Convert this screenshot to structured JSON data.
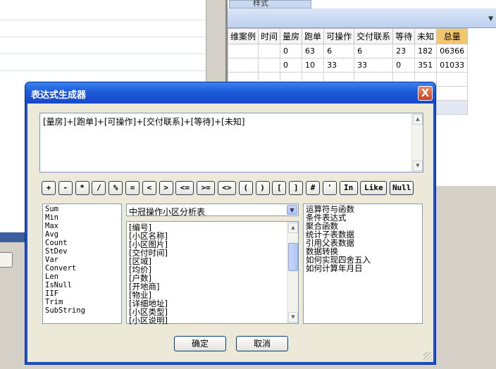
{
  "background": {
    "style_tab_label": "样式",
    "table": {
      "headers": [
        "维案例",
        "时间",
        "量房",
        "跑单",
        "可操作",
        "交付联系",
        "等待",
        "未知",
        "总量"
      ],
      "rows": [
        [
          "",
          "",
          "0",
          "63",
          "6",
          "6",
          "23",
          "182",
          "06366"
        ],
        [
          "",
          "",
          "0",
          "10",
          "33",
          "33",
          "0",
          "351",
          "01033"
        ]
      ]
    }
  },
  "dialog": {
    "title": "表达式生成器",
    "close_label": "X",
    "expression": "[量房]+[跑单]+[可操作]+[交付联系]+[等待]+[未知]",
    "operators": [
      "+",
      "-",
      "*",
      "/",
      "%",
      "=",
      "<",
      ">",
      "<=",
      ">=",
      "<>",
      "(",
      ")",
      "[",
      "]",
      "#",
      "'",
      "In",
      "Like",
      "Null"
    ],
    "functions": [
      "Sum",
      "Min",
      "Max",
      "Avg",
      "Count",
      "StDev",
      "Var",
      "Convert",
      "Len",
      "IsNull",
      "IIF",
      "Trim",
      "SubString"
    ],
    "table_select": {
      "selected": "中冠操作小区分析表"
    },
    "fields": [
      "[编号]",
      "[小区名称]",
      "[小区图片]",
      "[交付时间]",
      "[区域]",
      "[均价]",
      "[户数]",
      "[开地商]",
      "[物业]",
      "[详细地址]",
      "[小区类型]",
      "[小区说明]"
    ],
    "help_topics": [
      "运算符与函数",
      "条件表达式",
      "聚合函数",
      "统计子表数据",
      "引用父表数据",
      "数据转换",
      "如何实现四舍五入",
      "如何计算年月日"
    ],
    "ok_label": "确定",
    "cancel_label": "取消"
  },
  "colors": {
    "title_bar": "#1c5bd9",
    "dialog_bg": "#ece9d8",
    "close_button": "#c8401e",
    "total_header": "#f2c66a"
  }
}
